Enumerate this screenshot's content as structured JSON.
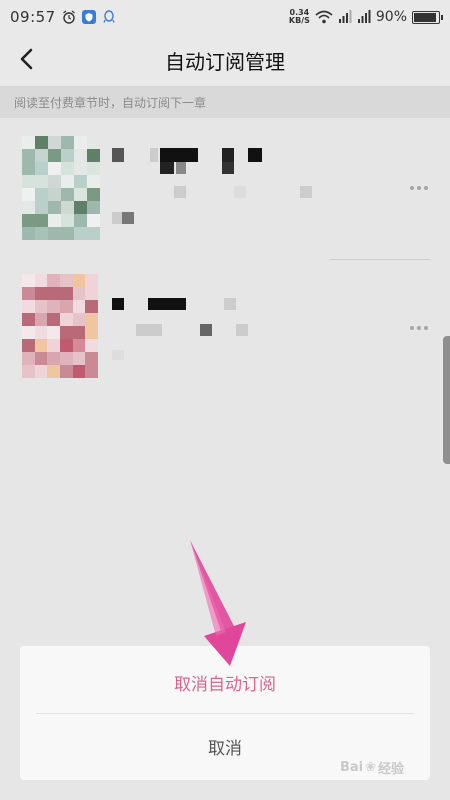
{
  "status_bar": {
    "time": "09:57",
    "net_speed_value": "0.34",
    "net_speed_unit": "KB/S",
    "battery_percent_text": "90%",
    "battery_level": 0.9
  },
  "nav": {
    "title": "自动订阅管理"
  },
  "hint": {
    "text": "阅读至付费章节时，自动订阅下一章"
  },
  "sheet": {
    "primary_label": "取消自动订阅",
    "cancel_label": "取消"
  },
  "watermark": {
    "text": "Bai",
    "text_suffix": "经验"
  },
  "colors": {
    "accent": "#d9668e",
    "arrow": "#e0479a"
  }
}
